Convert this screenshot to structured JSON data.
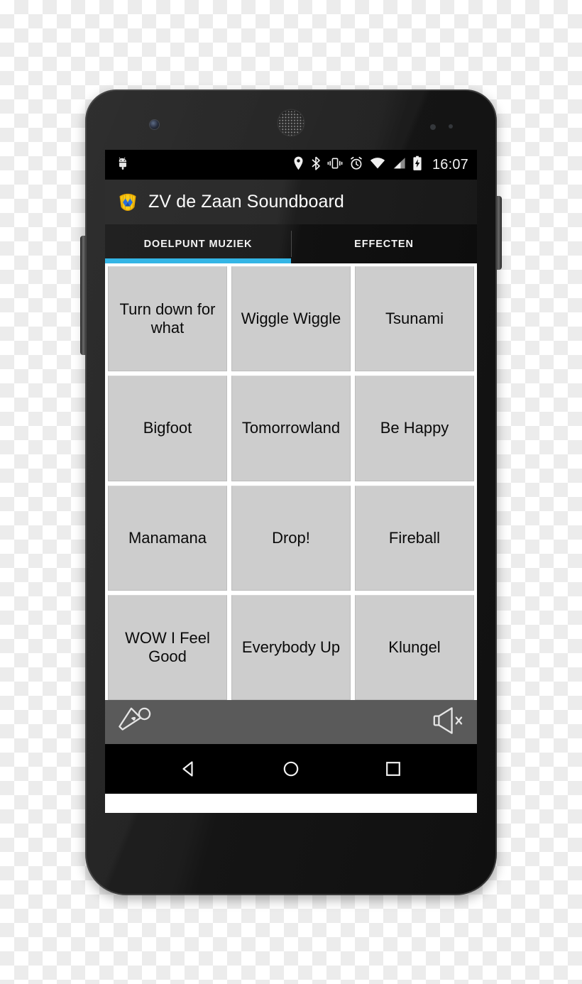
{
  "device": {
    "name": "android-smartphone",
    "hardware": {
      "front_camera": "camera-icon",
      "earpiece": "speaker-grille-icon",
      "sensors": "proximity-sensor-icon",
      "power_button": "power-button",
      "volume_button": "volume-rocker-button"
    }
  },
  "statusbar": {
    "notification_icon": "android-robot-icon",
    "icons": [
      {
        "name": "location-icon",
        "label": "Location"
      },
      {
        "name": "bluetooth-icon",
        "label": "Bluetooth"
      },
      {
        "name": "vibrate-icon",
        "label": "Vibrate"
      },
      {
        "name": "alarm-icon",
        "label": "Alarm"
      },
      {
        "name": "wifi-icon",
        "label": "Wi-Fi"
      },
      {
        "name": "cellular-signal-icon",
        "label": "Signal"
      },
      {
        "name": "battery-charging-icon",
        "label": "Battery charging"
      }
    ],
    "clock": "16:07"
  },
  "actionbar": {
    "logo": "app-logo-icon",
    "title": "ZV de Zaan Soundboard"
  },
  "tabs": [
    {
      "label": "DOELPUNT MUZIEK",
      "active": true
    },
    {
      "label": "EFFECTEN",
      "active": false
    }
  ],
  "grid": {
    "buttons": [
      {
        "label": "Turn down for what"
      },
      {
        "label": "Wiggle Wiggle"
      },
      {
        "label": "Tsunami"
      },
      {
        "label": "Bigfoot"
      },
      {
        "label": "Tomorrowland"
      },
      {
        "label": "Be Happy"
      },
      {
        "label": "Manamana"
      },
      {
        "label": "Drop!"
      },
      {
        "label": "Fireball"
      },
      {
        "label": "WOW I Feel Good"
      },
      {
        "label": "Everybody Up"
      },
      {
        "label": "Klungel"
      }
    ]
  },
  "controlbar": {
    "microphone": "microphone-icon",
    "mute": "speaker-mute-icon"
  },
  "navbar": {
    "back": "back-icon",
    "home": "home-icon",
    "recents": "recents-icon"
  },
  "colors": {
    "accent": "#33b5e5",
    "button_face": "#cdcdcd",
    "controlbar": "#5a5a5a",
    "logo_gold": "#f2c014",
    "logo_blue": "#2a6fdb"
  }
}
